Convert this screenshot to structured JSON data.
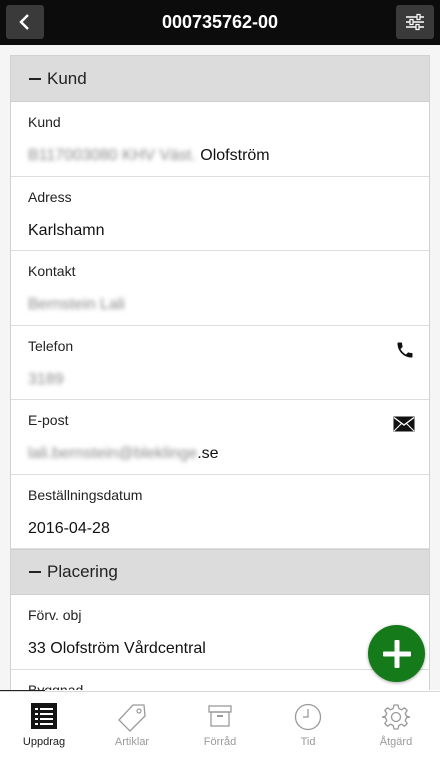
{
  "header": {
    "title": "000735762-00",
    "back_icon": "chevron-left-icon",
    "filter_icon": "sliders-icon"
  },
  "sections": [
    {
      "title": "Kund",
      "fields": [
        {
          "label": "Kund",
          "value_blurred": "B117003080 KHV Väst.",
          "value": " Olofström"
        },
        {
          "label": "Adress",
          "value_blurred": "",
          "value": "Karlshamn"
        },
        {
          "label": "Kontakt",
          "value_blurred": "Bernstein Lali",
          "value": ""
        },
        {
          "label": "Telefon",
          "value_blurred": "3189",
          "value": "",
          "icon": "phone-icon"
        },
        {
          "label": "E-post",
          "value_blurred": "lali.bernstein@bleklinge",
          "value": ".se",
          "icon": "mail-icon"
        },
        {
          "label": "Beställningsdatum",
          "value_blurred": "",
          "value": "2016-04-28"
        }
      ]
    },
    {
      "title": "Placering",
      "fields": [
        {
          "label": "Förv. obj",
          "value_blurred": "",
          "value": "33 Olofström Vårdcentral"
        },
        {
          "label": "Byggnad",
          "value_blurred": "",
          "value": ""
        }
      ]
    }
  ],
  "fab": {
    "icon": "plus-icon",
    "color": "#147a1a"
  },
  "tabbar": [
    {
      "label": "Uppdrag",
      "icon": "list-icon",
      "active": true
    },
    {
      "label": "Artiklar",
      "icon": "tag-icon",
      "active": false
    },
    {
      "label": "Förråd",
      "icon": "box-icon",
      "active": false
    },
    {
      "label": "Tid",
      "icon": "clock-icon",
      "active": false
    },
    {
      "label": "Åtgärd",
      "icon": "gear-icon",
      "active": false
    }
  ]
}
